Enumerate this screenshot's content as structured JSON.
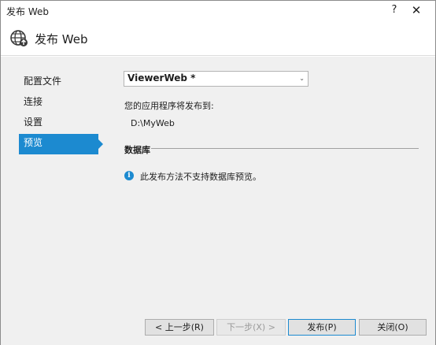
{
  "window": {
    "title": "发布 Web",
    "help_glyph": "?",
    "close_glyph": "✕"
  },
  "header": {
    "title": "发布 Web",
    "icon": "globe-upload-icon"
  },
  "nav": {
    "items": [
      {
        "label": "配置文件",
        "active": false
      },
      {
        "label": "连接",
        "active": false
      },
      {
        "label": "设置",
        "active": false
      },
      {
        "label": "预览",
        "active": true
      }
    ]
  },
  "profile": {
    "selected": "ViewerWeb *",
    "chevron": "⌄"
  },
  "preview": {
    "publish_to_label": "您的应用程序将发布到:",
    "publish_path": "D:\\MyWeb",
    "database_section_title": "数据库",
    "info_icon": "info-icon",
    "info_glyph": "i",
    "database_message": "此发布方法不支持数据库预览。"
  },
  "buttons": {
    "prev": "< 上一步(R)",
    "next": "下一步(X) >",
    "publish": "发布(P)",
    "close": "关闭(O)"
  },
  "colors": {
    "accent": "#1c8ad0",
    "content_bg": "#f0f0f0"
  }
}
